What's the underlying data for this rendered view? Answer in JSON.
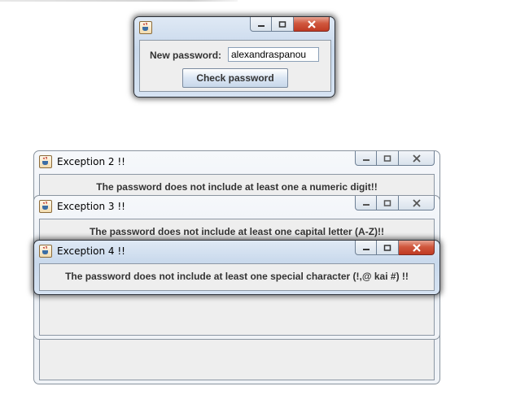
{
  "password_window": {
    "title": "",
    "label": "New password:",
    "input_value": "alexandraspanou",
    "button_label": "Check password"
  },
  "dialogs": [
    {
      "title": "Exception 2 !!",
      "message": "The password does not include at least one a numeric digit!!"
    },
    {
      "title": "Exception 3 !!",
      "message": "The password does not include at least one capital letter (A-Z)!!"
    },
    {
      "title": "Exception 4 !!",
      "message": "The password does not include at least one special character (!,@ kai #) !!"
    }
  ],
  "icons": {
    "app": "java-coffee-cup-icon",
    "minimize": "minimize-icon",
    "maximize": "maximize-icon",
    "close": "close-icon"
  },
  "colors": {
    "close_active": "#c8412a",
    "client_bg": "#eeeeee"
  }
}
